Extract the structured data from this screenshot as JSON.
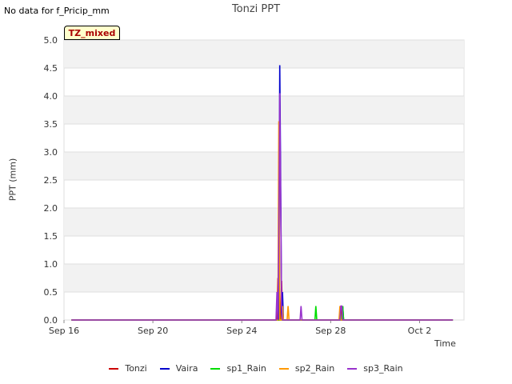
{
  "note": "No data for f_Pricip_mm",
  "tz_label": "TZ_mixed",
  "chart_data": {
    "type": "line",
    "title": "Tonzi PPT",
    "xlabel": "Time",
    "ylabel": "PPT (mm)",
    "ylim": [
      0,
      5.0
    ],
    "yticks": [
      0.0,
      0.5,
      1.0,
      1.5,
      2.0,
      2.5,
      3.0,
      3.5,
      4.0,
      4.5,
      5.0
    ],
    "ytick_labels": [
      "0.0",
      "0.5",
      "1.0",
      "1.5",
      "2.0",
      "2.5",
      "3.0",
      "3.5",
      "4.0",
      "4.5",
      "5.0"
    ],
    "xlim": [
      "2023-09-16",
      "2023-10-04"
    ],
    "xticks": [
      "2023-09-16",
      "2023-09-20",
      "2023-09-24",
      "2023-09-28",
      "2023-10-02"
    ],
    "xtick_labels": [
      "Sep 16",
      "Sep 20",
      "Sep 24",
      "Sep 28",
      "Oct 2"
    ],
    "grid": true,
    "legend_position": "bottom",
    "series": [
      {
        "name": "Tonzi",
        "color": "#cc0000",
        "points": [
          [
            "2023-09-16 08:00",
            0
          ],
          [
            "2023-09-25 14:00",
            0
          ],
          [
            "2023-09-25 15:00",
            0.75
          ],
          [
            "2023-09-25 16:00",
            0
          ],
          [
            "2023-09-25 18:00",
            0
          ],
          [
            "2023-09-25 19:00",
            0.7
          ],
          [
            "2023-09-25 20:00",
            0
          ],
          [
            "2023-09-28 10:00",
            0
          ],
          [
            "2023-09-28 11:00",
            0.25
          ],
          [
            "2023-09-28 12:00",
            0
          ],
          [
            "2023-10-03 12:00",
            0
          ]
        ]
      },
      {
        "name": "Vaira",
        "color": "#0000cc",
        "points": [
          [
            "2023-09-16 08:00",
            0
          ],
          [
            "2023-09-25 16:00",
            0
          ],
          [
            "2023-09-25 17:00",
            4.55
          ],
          [
            "2023-09-25 18:00",
            2.55
          ],
          [
            "2023-09-25 19:00",
            0
          ],
          [
            "2023-09-25 20:00",
            0.5
          ],
          [
            "2023-09-25 21:00",
            0
          ],
          [
            "2023-09-28 12:00",
            0
          ],
          [
            "2023-09-28 13:00",
            0.25
          ],
          [
            "2023-09-28 14:00",
            0
          ],
          [
            "2023-10-03 12:00",
            0
          ]
        ]
      },
      {
        "name": "sp1_Rain",
        "color": "#00dd00",
        "points": [
          [
            "2023-09-16 08:00",
            0
          ],
          [
            "2023-09-27 07:00",
            0
          ],
          [
            "2023-09-27 08:00",
            0.25
          ],
          [
            "2023-09-27 09:00",
            0
          ],
          [
            "2023-09-28 12:00",
            0
          ],
          [
            "2023-09-28 13:00",
            0.25
          ],
          [
            "2023-09-28 14:00",
            0
          ],
          [
            "2023-10-03 12:00",
            0
          ]
        ]
      },
      {
        "name": "sp2_Rain",
        "color": "#ff9900",
        "points": [
          [
            "2023-09-16 08:00",
            0
          ],
          [
            "2023-09-25 15:00",
            0
          ],
          [
            "2023-09-25 16:00",
            3.55
          ],
          [
            "2023-09-25 17:00",
            0
          ],
          [
            "2023-09-25 19:00",
            0
          ],
          [
            "2023-09-25 20:00",
            0.25
          ],
          [
            "2023-09-25 21:00",
            0
          ],
          [
            "2023-09-26 01:00",
            0
          ],
          [
            "2023-09-26 02:00",
            0.25
          ],
          [
            "2023-09-26 03:00",
            0
          ],
          [
            "2023-09-28 09:00",
            0
          ],
          [
            "2023-09-28 10:00",
            0.25
          ],
          [
            "2023-09-28 11:00",
            0
          ],
          [
            "2023-10-03 12:00",
            0
          ]
        ]
      },
      {
        "name": "sp3_Rain",
        "color": "#9933cc",
        "points": [
          [
            "2023-09-16 08:00",
            0
          ],
          [
            "2023-09-25 13:00",
            0
          ],
          [
            "2023-09-25 14:00",
            0.5
          ],
          [
            "2023-09-25 15:00",
            0
          ],
          [
            "2023-09-25 16:00",
            1.5
          ],
          [
            "2023-09-25 17:00",
            4.05
          ],
          [
            "2023-09-25 18:00",
            2.25
          ],
          [
            "2023-09-25 19:00",
            0.25
          ],
          [
            "2023-09-25 20:00",
            0
          ],
          [
            "2023-09-26 15:00",
            0
          ],
          [
            "2023-09-26 16:00",
            0.25
          ],
          [
            "2023-09-26 17:00",
            0
          ],
          [
            "2023-09-28 10:00",
            0
          ],
          [
            "2023-09-28 11:00",
            0.25
          ],
          [
            "2023-09-28 12:00",
            0.25
          ],
          [
            "2023-09-28 13:00",
            0
          ],
          [
            "2023-10-03 12:00",
            0
          ]
        ]
      }
    ]
  }
}
